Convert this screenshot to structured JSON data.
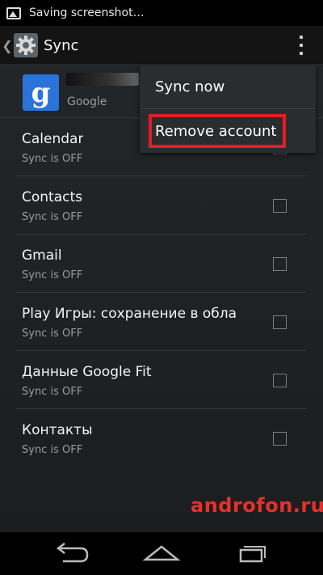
{
  "status_bar": {
    "text": "Saving screenshot…",
    "icon": "image-icon"
  },
  "action_bar": {
    "title": "Sync",
    "icons": [
      "up-caret-icon",
      "settings-gear-icon",
      "overflow-menu-icon"
    ]
  },
  "account": {
    "type": "Google",
    "logo_letter": "g",
    "logo_color": "#2a73d9"
  },
  "sync_items": [
    {
      "label": "Calendar",
      "status": "Sync is OFF",
      "checked": false
    },
    {
      "label": "Contacts",
      "status": "Sync is OFF",
      "checked": false
    },
    {
      "label": "Gmail",
      "status": "Sync is OFF",
      "checked": false
    },
    {
      "label": "Play Игры: сохранение в обла",
      "status": "Sync is OFF",
      "checked": false
    },
    {
      "label": "Данные Google Fit",
      "status": "Sync is OFF",
      "checked": false
    },
    {
      "label": "Контакты",
      "status": "Sync is OFF",
      "checked": false
    }
  ],
  "menu": {
    "items": [
      {
        "label": "Sync now"
      },
      {
        "label": "Remove account"
      }
    ],
    "highlight_color": "#e51c23"
  },
  "watermark": "androfon.ru",
  "nav": {
    "icons": [
      "back-icon",
      "home-icon",
      "recent-apps-icon"
    ]
  }
}
